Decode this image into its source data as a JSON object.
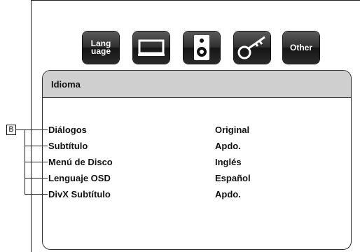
{
  "toolbar": {
    "language_icon_text_line1": "Lang",
    "language_icon_text_line2": "uage",
    "other_icon_text": "Other"
  },
  "panel": {
    "title": "Idioma"
  },
  "callout": {
    "label": "B"
  },
  "settings": [
    {
      "label": "Diálogos",
      "value": "Original"
    },
    {
      "label": "Subtítulo",
      "value": "Apdo."
    },
    {
      "label": "Menú de Disco",
      "value": "Inglés"
    },
    {
      "label": "Lenguaje OSD",
      "value": "Español"
    },
    {
      "label": "DivX Subtítulo",
      "value": "Apdo."
    }
  ],
  "icons": [
    "language-icon",
    "display-icon",
    "speaker-icon",
    "key-icon",
    "other-icon"
  ]
}
